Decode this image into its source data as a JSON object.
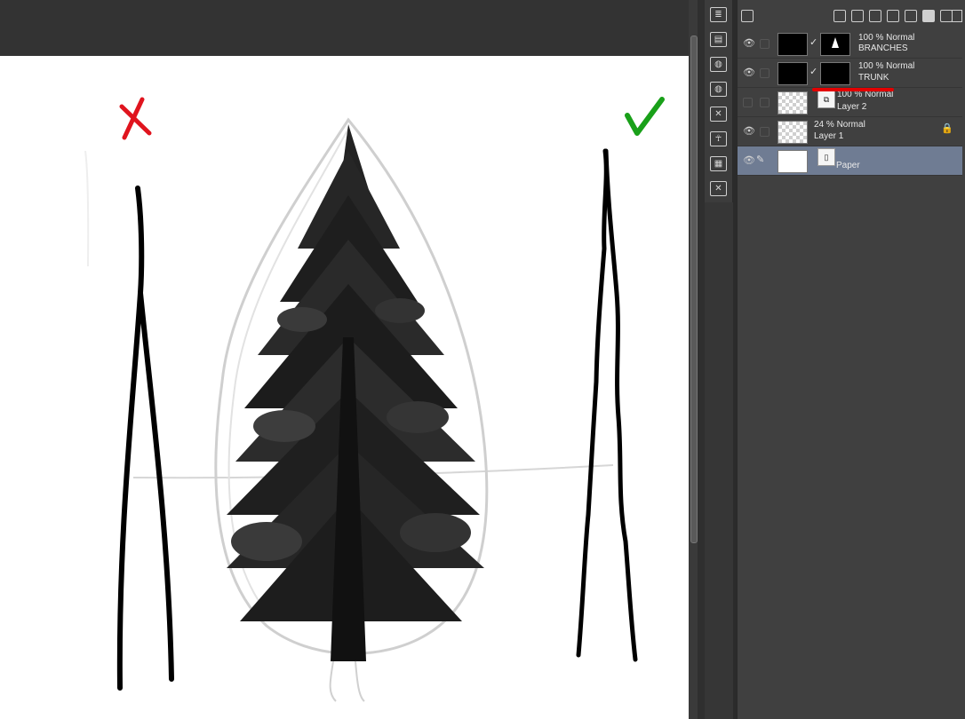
{
  "toolbar": {
    "icons": [
      "new-raster-layer-icon",
      "new-vector-layer-icon",
      "new-folder-icon",
      "copy-layer-icon",
      "merge-layer-icon",
      "layer-mask-icon",
      "apply-mask-icon",
      "delete-layer-icon"
    ]
  },
  "side_icons": [
    "layer-property-icon",
    "layer-search-icon",
    "material-icon",
    "material-icon-2",
    "close-icon",
    "pose-icon",
    "timeline-icon",
    "close-icon-2"
  ],
  "layers": [
    {
      "blend": "100 % Normal",
      "name": "BRANCHES",
      "visible": true,
      "thumb": "black",
      "mask": "tree",
      "selected": false,
      "clip": true
    },
    {
      "blend": "100 % Normal",
      "name": "TRUNK",
      "visible": true,
      "thumb": "black",
      "mask": "black",
      "selected": false,
      "clip": true
    },
    {
      "blend": "100 % Normal",
      "name": "Layer 2",
      "visible": false,
      "thumb": "check",
      "mask": "layer",
      "selected": false,
      "clip": false
    },
    {
      "blend": "24 % Normal",
      "name": "Layer 1",
      "visible": true,
      "thumb": "check",
      "locked": true,
      "selected": false,
      "clip": false
    },
    {
      "blend": "",
      "name": "Paper",
      "visible": true,
      "thumb": "white",
      "selected": true,
      "clip": false
    }
  ],
  "canvas": {
    "wrong_mark": "✗",
    "right_mark": "✓",
    "wrong_color": "#e0141e",
    "right_color": "#19a019"
  },
  "colors": {
    "selected_layer": "#6f7c93",
    "highlight_line": "#e30000"
  }
}
